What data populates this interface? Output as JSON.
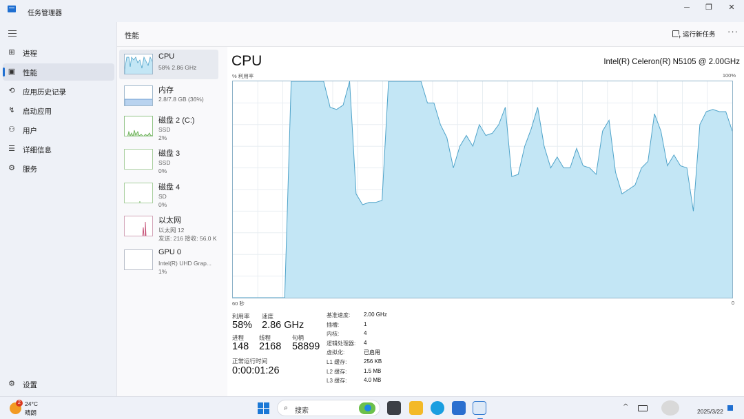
{
  "window": {
    "title": "任务管理器",
    "controls": {
      "minimize": "─",
      "restore": "❐",
      "close": "✕"
    }
  },
  "nav": {
    "menu_icon": "hamburger-icon",
    "items": [
      {
        "label": "进程",
        "icon": "processes-icon",
        "active": false
      },
      {
        "label": "性能",
        "icon": "performance-icon",
        "active": true
      },
      {
        "label": "应用历史记录",
        "icon": "history-icon",
        "active": false
      },
      {
        "label": "启动应用",
        "icon": "startup-icon",
        "active": false
      },
      {
        "label": "用户",
        "icon": "users-icon",
        "active": false
      },
      {
        "label": "详细信息",
        "icon": "details-icon",
        "active": false
      },
      {
        "label": "服务",
        "icon": "services-icon",
        "active": false
      }
    ],
    "settings": {
      "label": "设置",
      "icon": "gear-icon"
    }
  },
  "header": {
    "title": "性能",
    "run_task": "运行新任务",
    "more": "···"
  },
  "devices": [
    {
      "name": "CPU",
      "sub1": "58%  2.86 GHz",
      "sub2": "",
      "sub3": "",
      "active": true
    },
    {
      "name": "内存",
      "sub1": "2.8/7.8 GB (36%)",
      "sub2": "",
      "sub3": "",
      "active": false
    },
    {
      "name": "磁盘 2 (C:)",
      "sub1": "SSD",
      "sub2": "2%",
      "sub3": "",
      "active": false
    },
    {
      "name": "磁盘 3",
      "sub1": "SSD",
      "sub2": "0%",
      "sub3": "",
      "active": false
    },
    {
      "name": "磁盘 4",
      "sub1": "SD",
      "sub2": "0%",
      "sub3": "",
      "active": false
    },
    {
      "name": "以太网",
      "sub1": "以太网 12",
      "sub2": "发送: 216  接收: 56.0 K",
      "sub3": "",
      "active": false
    },
    {
      "name": "GPU 0",
      "sub1": "Intel(R) UHD Grap...",
      "sub2": "1%",
      "sub3": "",
      "active": false
    }
  ],
  "detail": {
    "title": "CPU",
    "model": "Intel(R) Celeron(R) N5105 @ 2.00GHz",
    "axis": {
      "top_left": "% 利用率",
      "top_right": "100%",
      "bottom_left": "60 秒",
      "bottom_right": "0"
    },
    "stats": {
      "utilization_label": "利用率",
      "utilization": "58%",
      "speed_label": "速度",
      "speed": "2.86 GHz",
      "processes_label": "进程",
      "processes": "148",
      "threads_label": "线程",
      "threads": "2168",
      "handles_label": "句柄",
      "handles": "58899",
      "uptime_label": "正常运行时间",
      "uptime": "0:00:01:26"
    },
    "properties": [
      {
        "label": "基准速度:",
        "value": "2.00 GHz"
      },
      {
        "label": "插槽:",
        "value": "1"
      },
      {
        "label": "内核:",
        "value": "4"
      },
      {
        "label": "逻辑处理器:",
        "value": "4"
      },
      {
        "label": "虚拟化:",
        "value": "已启用"
      },
      {
        "label": "L1 缓存:",
        "value": "256 KB"
      },
      {
        "label": "L2 缓存:",
        "value": "1.5 MB"
      },
      {
        "label": "L3 缓存:",
        "value": "4.0 MB"
      }
    ]
  },
  "cpu_graph": {
    "x_range_seconds": [
      60,
      0
    ],
    "y_range_percent": [
      0,
      100
    ],
    "utilization_percent": [
      0,
      0,
      0,
      0,
      0,
      0,
      0,
      0,
      0,
      100,
      100,
      100,
      100,
      100,
      100,
      88,
      87,
      89,
      100,
      48,
      43,
      44,
      44,
      45,
      100,
      100,
      100,
      100,
      100,
      100,
      90,
      90,
      80,
      74,
      60,
      70,
      75,
      70,
      80,
      75,
      76,
      80,
      88,
      56,
      57,
      70,
      78,
      88,
      70,
      60,
      65,
      60,
      60,
      69,
      61,
      60,
      57,
      77,
      82,
      58,
      48,
      50,
      52,
      60,
      63,
      85,
      77,
      61,
      66,
      61,
      60,
      40,
      80,
      86,
      87,
      86,
      86,
      77
    ]
  },
  "taskbar": {
    "weather_temp": "24°C",
    "weather_desc": "晴朗",
    "weather_badge": "2",
    "search_label": "搜索",
    "date": "2025/3/22",
    "tray_chevron": "^"
  },
  "colors": {
    "accent": "#1f6fd1",
    "cpu_fill": "#c3e6f5",
    "cpu_line": "#4fa3c9",
    "nav_bg": "#eef1f7"
  }
}
